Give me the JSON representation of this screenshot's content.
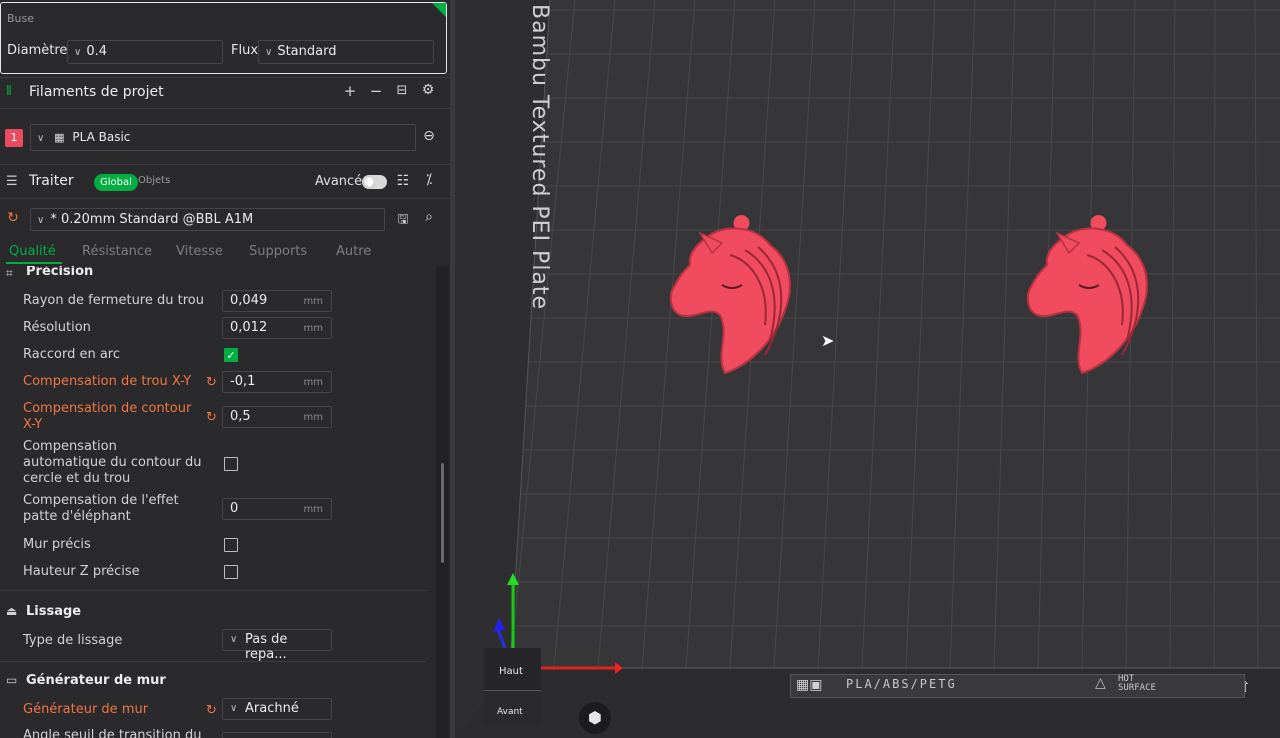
{
  "nozzle": {
    "title": "Buse",
    "diameter_label": "Diamètre",
    "diameter_value": "0.4",
    "flow_label": "Flux",
    "flow_value": "Standard"
  },
  "filaments": {
    "title": "Filaments de projet",
    "items": [
      {
        "index": "1",
        "name": "PLA Basic",
        "color": "#e84c5e"
      }
    ]
  },
  "process": {
    "title": "Traiter",
    "scope_global": "Global",
    "scope_objects": "Objets",
    "advanced_label": "Avancé",
    "profile": "* 0.20mm Standard @BBL A1M",
    "tabs": [
      "Qualité",
      "Résistance",
      "Vitesse",
      "Supports",
      "Autre"
    ],
    "active_tab": "Qualité"
  },
  "settings": {
    "precision_group": "Précision",
    "hole_closing_radius": {
      "label": "Rayon de fermeture du trou",
      "value": "0,049",
      "unit": "mm"
    },
    "resolution": {
      "label": "Résolution",
      "value": "0,012",
      "unit": "mm"
    },
    "arc_fitting": {
      "label": "Raccord en arc",
      "checked": true
    },
    "xy_hole_comp": {
      "label": "Compensation de trou X-Y",
      "value": "-0,1",
      "unit": "mm"
    },
    "xy_contour_comp": {
      "label": "Compensation de contour X-Y",
      "value": "0,5",
      "unit": "mm"
    },
    "auto_circle_comp": {
      "label": "Compensation automatique du contour du cercle et du trou",
      "checked": false
    },
    "elephant_foot": {
      "label": "Compensation de l'effet patte d'éléphant",
      "value": "0",
      "unit": "mm"
    },
    "precise_wall": {
      "label": "Mur précis",
      "checked": false
    },
    "precise_z": {
      "label": "Hauteur Z précise",
      "checked": false
    },
    "ironing_group": "Lissage",
    "ironing_type": {
      "label": "Type de lissage",
      "value": "Pas de repa..."
    },
    "wall_gen_group": "Générateur de mur",
    "wall_generator": {
      "label": "Générateur de mur",
      "value": "Arachné"
    },
    "transition_label": "Angle seuil de transition du"
  },
  "viewport": {
    "plate_name": "Bambu Textured PEI Plate",
    "plate_strip_text": "PLA/ABS/PETG",
    "hot_surface_line1": "HOT",
    "hot_surface_line2": "SURFACE",
    "cube_top": "Haut",
    "cube_front": "Avant",
    "model_color": "#f04b5f",
    "accent_color": "#00ae42"
  }
}
